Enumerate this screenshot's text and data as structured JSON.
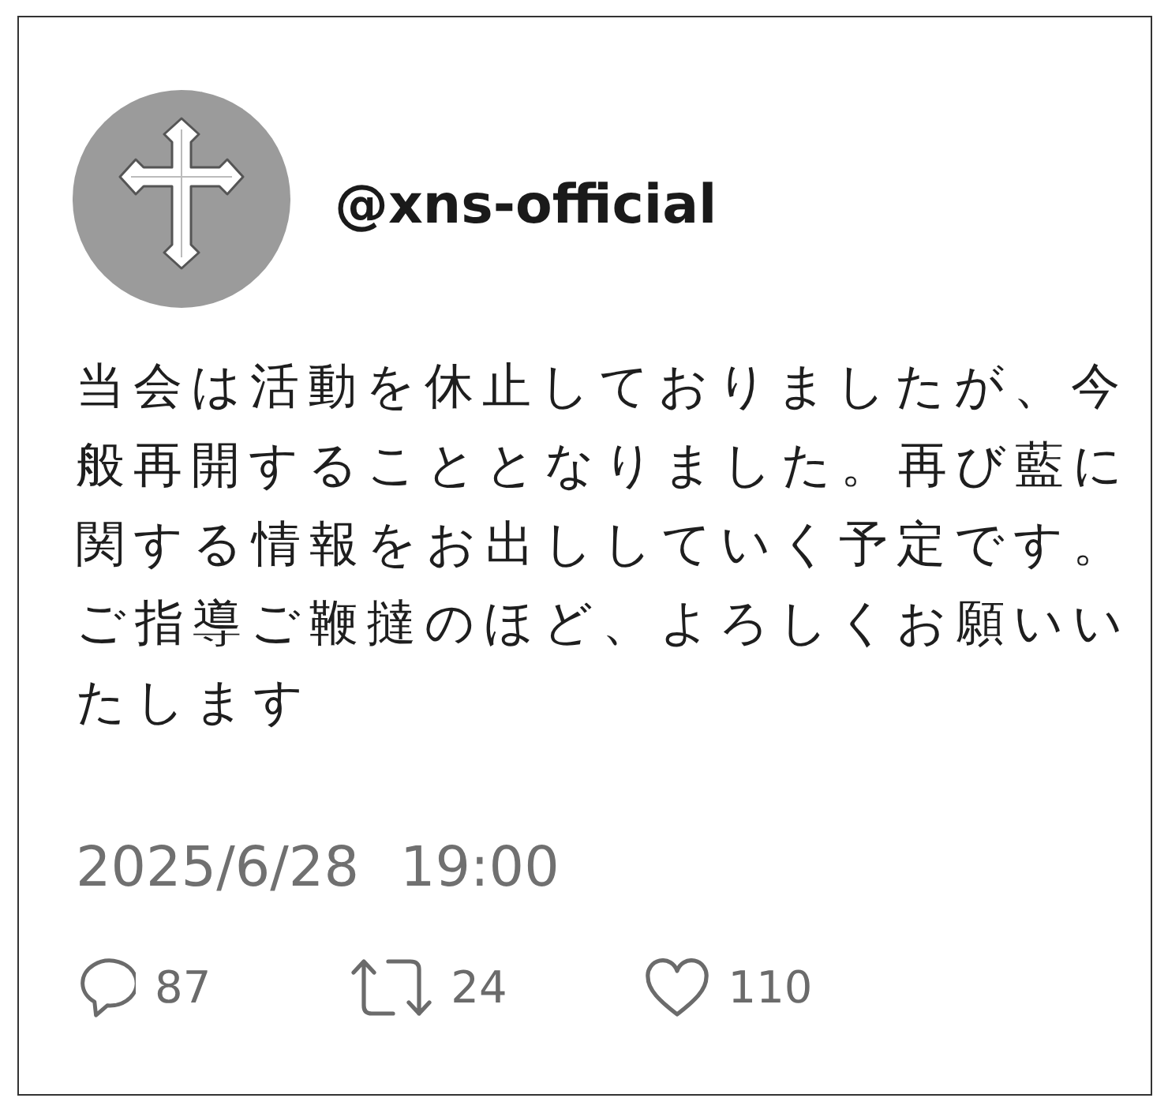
{
  "account": {
    "handle": "@xns-official"
  },
  "post": {
    "text": "当会は活動を休止しておりましたが、今般再開することとなりました。再び藍に関する情報をお出ししていく予定です。ご指導ご鞭撻のほど、よろしくお願いいたします"
  },
  "timestamp": {
    "date": "2025/6/28",
    "time": "19:00"
  },
  "stats": [
    {
      "kind": "reply",
      "count": "87"
    },
    {
      "kind": "repost",
      "count": "24"
    },
    {
      "kind": "like",
      "count": "110"
    }
  ]
}
